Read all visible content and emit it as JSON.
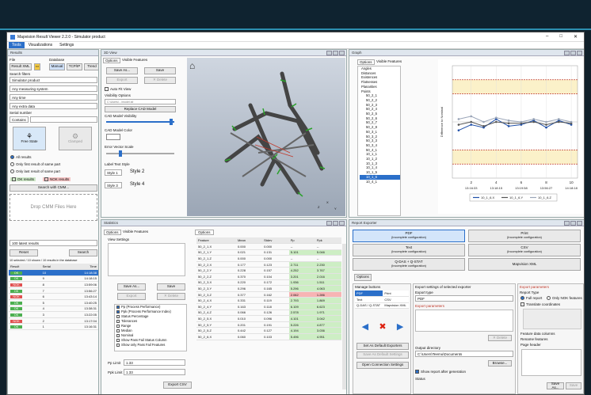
{
  "window": {
    "title": "Mapvision Result Viewer 2.2.0 - Simulator product",
    "minimize": "–",
    "maximize": "□",
    "close": "✕"
  },
  "menu": [
    "Tools",
    "Visualizations",
    "Settings"
  ],
  "results": {
    "title": "Results",
    "file_label": "File",
    "database_label": "Database",
    "result_xml": "Result XML",
    "manual": "Manual",
    "tcp_ip": "TCP/IP",
    "trend": "Trend",
    "search_filters": "Search filters",
    "filters": [
      "Simulator product",
      "Any measuring system",
      "Any time",
      "Any extra data"
    ],
    "serial_label": "Serial number",
    "contains": "Contains",
    "free_state": "Free State",
    "clamped": "Clamped",
    "radios": [
      "All results",
      "Only first result of same part",
      "Only last result of same part"
    ],
    "ok_results": "OK results",
    "nok_results": "NOK results",
    "search_cmm": "Search with CMM...",
    "drop": "Drop CMM Files Here",
    "latest": "100 latest results",
    "reset": "Reset",
    "search": "Search",
    "info": "10 selected / 10 shown / 10 results in the database",
    "cols": [
      "Result",
      "Serial",
      "Time"
    ],
    "rows": [
      {
        "r": "OK",
        "s": "10",
        "t": "14:18:38",
        "sel": true
      },
      {
        "r": "OK",
        "s": "9",
        "t": "14:18:15"
      },
      {
        "r": "NOK",
        "s": "8",
        "t": "13:59:06"
      },
      {
        "r": "OK",
        "s": "7",
        "t": "13:56:27"
      },
      {
        "r": "NOK",
        "s": "6",
        "t": "13:43:14"
      },
      {
        "r": "OK",
        "s": "5",
        "t": "13:40:25"
      },
      {
        "r": "OK",
        "s": "4",
        "t": "13:38:31"
      },
      {
        "r": "OK",
        "s": "3",
        "t": "13:22:05"
      },
      {
        "r": "NOK",
        "s": "2",
        "t": "13:17:04"
      },
      {
        "r": "OK",
        "s": "1",
        "t": "13:16:31"
      }
    ]
  },
  "view3d": {
    "title": "3D View",
    "tabs": [
      "Options",
      "Visible Features"
    ],
    "save_as": "Save As...",
    "save": "Save",
    "export": "Export",
    "delete": "✕ Delete",
    "autofit": "Auto Fit View",
    "visibility": "Visibility Options",
    "cad_path": "C:\\Users\\...\\model.stl",
    "replace_cad": "Replace CAD Model",
    "cad_vis": "CAD Model Visibility",
    "cad_color": "CAD Model Color",
    "err_scale": "Error Vector Scale",
    "label_style": "Label Text Style",
    "style1": "Style 1",
    "style2": "Style 2",
    "style3": "Style 3",
    "style4": "Style 4"
  },
  "graph": {
    "title": "Graph",
    "tabs": [
      "Options",
      "Visible Features"
    ],
    "tree": [
      "Angles",
      "Distances",
      "Existences",
      "Flatnesses",
      "Planarities",
      "Points",
      "50_2_1",
      "50_2_2",
      "50_2_3",
      "50_2_4",
      "50_2_5",
      "50_2_6",
      "50_2_7",
      "50_2_8",
      "50_3_1",
      "50_3_2",
      "50_3_3",
      "50_3_4",
      "50_4_1",
      "10_1_1",
      "10_1_2",
      "10_1_3",
      "10_1_4",
      "10_1_5",
      "10_1_6",
      "10_4_1"
    ],
    "selected": "10_1_6",
    "ylabel": "Difference to Nominal",
    "legend": [
      "10_1_6,X",
      "10_1_6,Y",
      "10_1_6,Z"
    ]
  },
  "chart_data": {
    "type": "line",
    "x": [
      1,
      2,
      3,
      4,
      5,
      6,
      7,
      8,
      9,
      10
    ],
    "xticks": [
      2,
      4,
      6,
      8,
      10
    ],
    "xtimes": [
      "13:16:33",
      "13:18:15",
      "13:19:58",
      "13:56:27",
      "14:18:18"
    ],
    "ylim": [
      -2,
      2
    ],
    "limit_lines": [
      1.5,
      1,
      -1,
      -1.5
    ],
    "series": [
      {
        "name": "10_1_6,X",
        "color": "#1f4fa8",
        "values": [
          -0.3,
          -0.1,
          -0.2,
          0.1,
          -0.15,
          -0.1,
          0.05,
          -0.2,
          0.05,
          -0.1
        ]
      },
      {
        "name": "10_1_6,Y",
        "color": "#555555",
        "values": [
          -0.1,
          0.0,
          -0.15,
          0.0,
          -0.05,
          -0.05,
          0.0,
          -0.1,
          0.0,
          -0.05
        ]
      },
      {
        "name": "10_1_6,Z",
        "color": "#9aa5b8",
        "values": [
          0.1,
          0.2,
          0.0,
          0.15,
          0.05,
          0.0,
          0.1,
          0.0,
          0.1,
          0.0
        ]
      }
    ],
    "grid": true,
    "legend": "bottom"
  },
  "stats": {
    "title": "Statistics",
    "tabs": [
      "Options",
      "Visible Features"
    ],
    "options_tab": "Options",
    "view_settings": "View Settings",
    "save_as": "Save As...",
    "save": "Save",
    "export": "Export",
    "delete": "✕ Delete",
    "checks": [
      "Pp (Process Performance)",
      "Ppk (Process Performance Index)",
      "Status Percentage",
      "Tolerances",
      "Range",
      "Median",
      "Nominal",
      "Show Pass Fail Status Column",
      "Show only Pass Fail Features"
    ],
    "pp_limit": "Pp Limit",
    "pp_val": "1.33",
    "ppk_limit": "Ppk Limit",
    "ppk_val": "1.33",
    "export_csv": "Export CSV",
    "cols": [
      "Feature",
      "Mean",
      "Stdev",
      "Pp",
      "Ppk"
    ],
    "rows": [
      [
        "50_2_1,X",
        "0.000",
        "0.000",
        "--",
        "--",
        ""
      ],
      [
        "50_2_1,Y",
        "0.021",
        "0.131",
        "5.101",
        "5.046",
        ""
      ],
      [
        "50_2_1,Z",
        "0.000",
        "0.000",
        "--",
        "--",
        ""
      ],
      [
        "50_2_2,X",
        "0.177",
        "0.123",
        "2.711",
        "2.230",
        ""
      ],
      [
        "50_2_2,Y",
        "0.228",
        "0.157",
        "4.252",
        "3.767",
        ""
      ],
      [
        "50_2_2,Z",
        "0.370",
        "0.104",
        "3.201",
        "2.016",
        ""
      ],
      [
        "50_2_3,X",
        "0.220",
        "0.172",
        "1.936",
        "1.511",
        ""
      ],
      [
        "50_2_3,Y",
        "0.296",
        "0.165",
        "5.296",
        "4.063",
        ""
      ],
      [
        "50_2_3,Z",
        "0.377",
        "0.162",
        "2.062",
        "1.286",
        "bad"
      ],
      [
        "50_2_4,X",
        "0.331",
        "0.119",
        "2.793",
        "1.869",
        ""
      ],
      [
        "50_2_4,Y",
        "0.163",
        "0.118",
        "6.109",
        "6.623",
        ""
      ],
      [
        "50_2_4,Z",
        "0.066",
        "0.126",
        "2.578",
        "1.971",
        ""
      ],
      [
        "50_2_5,X",
        "0.010",
        "0.096",
        "4.101",
        "3.042",
        ""
      ],
      [
        "50_2_5,Y",
        "0.201",
        "0.191",
        "5.226",
        "4.877",
        ""
      ],
      [
        "50_2_5,Z",
        "0.442",
        "0.127",
        "4.194",
        "3.036",
        ""
      ],
      [
        "50_2_6,X",
        "0.060",
        "0.103",
        "5.496",
        "4.951",
        ""
      ]
    ]
  },
  "exporter": {
    "title": "Report Exporter",
    "buttons": [
      {
        "t": "PDF",
        "s": "(Incomplete configuration)",
        "sel": true
      },
      {
        "t": "Print",
        "s": "(Incomplete configuration)"
      },
      {
        "t": "Text",
        "s": "(Incomplete configuration)"
      },
      {
        "t": "CSV",
        "s": "(Incomplete configuration)"
      },
      {
        "t": "Q-DAS + Q-STAT",
        "s": "(Incomplete configuration)"
      },
      {
        "t": "Mapvision XML",
        "s": ""
      }
    ],
    "options": "Options",
    "manage": "Manage buttons",
    "list": [
      [
        "PDF",
        "Print"
      ],
      [
        "Text",
        "CSV"
      ],
      [
        "Q-DAS / Q-STAT",
        "Mapvision XML"
      ]
    ],
    "set_default": "Set As Default Exporters",
    "save_default": "Save As Default Settings",
    "open_conn": "Open Connection Settings",
    "settings_title": "Export settings of selected exporter",
    "export_type": "Export type",
    "export_type_val": "PDF",
    "report_params": "Export parameters",
    "delete": "✕ Delete",
    "out_dir": "Output directory",
    "out_val": "C:\\Users\\Teemu\\Documents",
    "browse": "Browse...",
    "show_report": "Show report after generation",
    "status": "Status",
    "params_title": "Export parameters",
    "report_type": "Report Type",
    "full_report": "Full report",
    "only_nok": "Only NOK features",
    "translate": "Translate coordinates",
    "feature_cols": "Feature data columns",
    "rename": "Rename features",
    "page_header": "Page header",
    "save_as": "Save As...",
    "save": "Save"
  }
}
